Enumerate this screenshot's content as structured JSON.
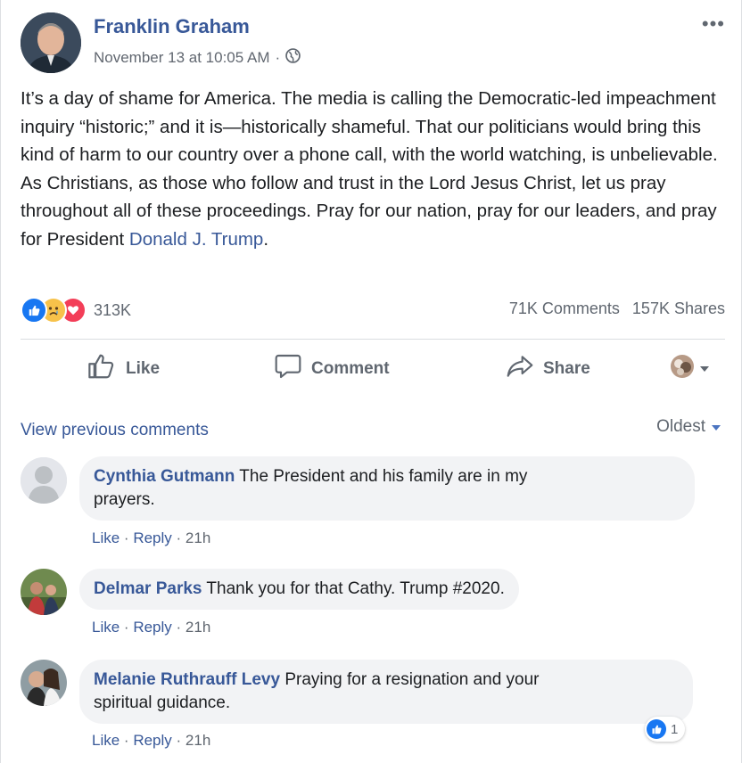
{
  "post": {
    "author": "Franklin Graham",
    "date": "November 13 at 10:05 AM",
    "separator": "·",
    "more": "•••",
    "text": "It’s a day of shame for America. The media is calling the Democratic-led impeachment inquiry “historic;” and it is—historically shameful. That our politicians would bring this kind of harm to our country over a phone call, with the world watching, is unbelievable. As Christians, as those who follow and trust in the Lord Jesus Christ, let us pray throughout all of these proceedings. Pray for our nation, pray for our leaders, and pray for President ",
    "link_text": "Donald J. Trump",
    "text_end": ".",
    "reaction_count": "313K",
    "comments_count": "71K Comments",
    "shares_count": "157K Shares"
  },
  "actions": {
    "like": "Like",
    "comment": "Comment",
    "share": "Share"
  },
  "comments_section": {
    "view_previous": "View previous comments",
    "sort": "Oldest",
    "items": [
      {
        "name": "Cynthia Gutmann",
        "text_line1": "The President and his family are in my",
        "text_line2": "prayers.",
        "like": "Like",
        "reply": "Reply",
        "time": "21h"
      },
      {
        "name": "Delmar Parks",
        "text_line1": "Thank you for that Cathy. Trump #2020.",
        "like": "Like",
        "reply": "Reply",
        "time": "21h"
      },
      {
        "name": "Melanie Ruthrauff Levy",
        "text_line1": "Praying for a resignation and your",
        "text_line2": "spiritual guidance.",
        "like": "Like",
        "reply": "Reply",
        "time": "21h",
        "like_count": "1"
      }
    ]
  },
  "colors": {
    "link": "#385898",
    "meta": "#606770",
    "bubble": "#f2f3f5",
    "like_blue": "#1877f2",
    "love_red": "#f33e58",
    "sad_yellow": "#f7c24a"
  },
  "icons": [
    "globe-icon",
    "like-reaction-icon",
    "sad-reaction-icon",
    "love-reaction-icon",
    "thumbs-up-icon",
    "comment-bubble-icon",
    "share-arrow-icon",
    "dropdown-caret-icon"
  ]
}
